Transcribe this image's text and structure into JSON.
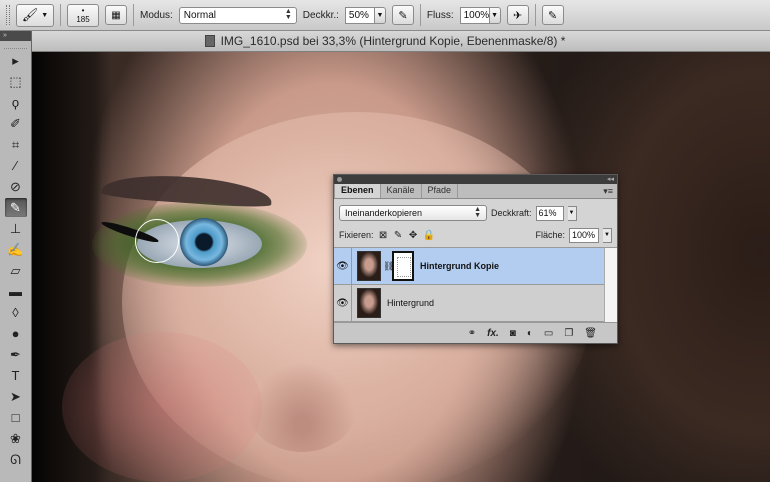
{
  "options_bar": {
    "brush_size": "185",
    "mode_label": "Modus:",
    "mode_value": "Normal",
    "opacity_label": "Deckkr.:",
    "opacity_value": "50%",
    "flow_label": "Fluss:",
    "flow_value": "100%"
  },
  "document": {
    "title": "IMG_1610.psd bei 33,3% (Hintergrund Kopie, Ebenenmaske/8) *"
  },
  "tools": {
    "items": [
      "move-tool-icon",
      "marquee-tool-icon",
      "lasso-tool-icon",
      "quick-selection-icon",
      "crop-tool-icon",
      "eyedropper-icon",
      "healing-brush-icon",
      "brush-tool-icon",
      "clone-stamp-icon",
      "history-brush-icon",
      "eraser-icon",
      "gradient-icon",
      "blur-icon",
      "dodge-icon",
      "pen-icon",
      "type-icon",
      "path-selection-icon",
      "rectangle-icon",
      "3d-rotate-icon",
      "3d-orbit-icon"
    ],
    "active": "brush-tool-icon"
  },
  "layers_panel": {
    "tabs": [
      "Ebenen",
      "Kanäle",
      "Pfade"
    ],
    "active_tab": "Ebenen",
    "blend_mode": "Ineinanderkopieren",
    "opacity_label": "Deckkraft:",
    "opacity_value": "61%",
    "lock_label": "Fixieren:",
    "fill_label": "Fläche:",
    "fill_value": "100%",
    "layers": [
      {
        "name": "Hintergrund Kopie",
        "selected": true,
        "has_mask": true
      },
      {
        "name": "Hintergrund",
        "selected": false,
        "has_mask": false
      }
    ],
    "footer_icons": [
      "link-icon",
      "fx-icon",
      "mask-icon",
      "adjustment-icon",
      "group-folder-icon",
      "new-layer-icon",
      "trash-icon"
    ],
    "fx_label": "fx."
  },
  "colors": {
    "selected_layer": "#b3cdf0",
    "panel_bg": "#d4d4d4",
    "eyeshadow": "#2f6a1f",
    "iris": "#6aaedc"
  }
}
